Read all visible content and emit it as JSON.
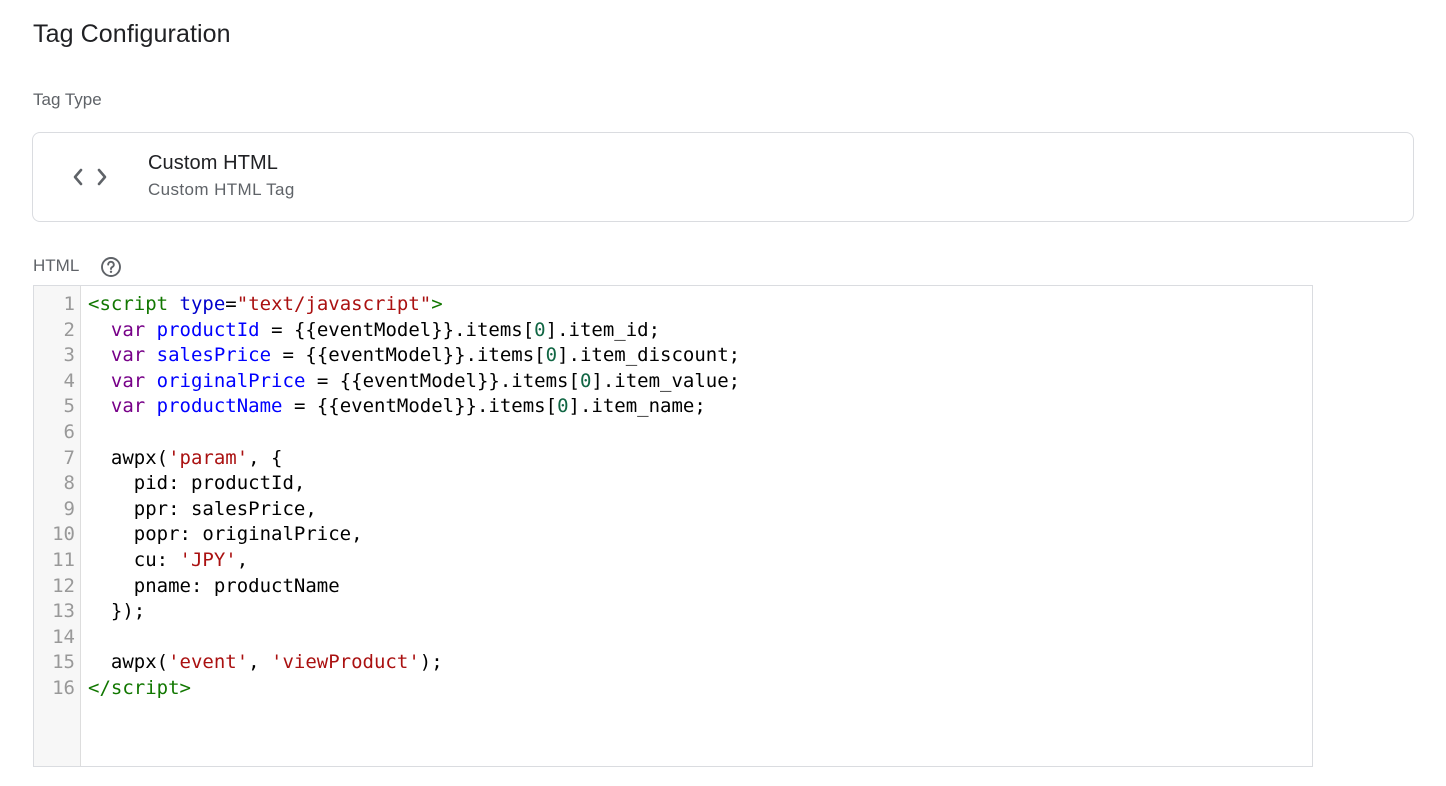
{
  "page": {
    "title": "Tag Configuration"
  },
  "tag_type": {
    "label": "Tag Type",
    "icon": "code-brackets-icon",
    "name": "Custom HTML",
    "description": "Custom HTML Tag"
  },
  "html_field": {
    "label": "HTML",
    "help_icon": "help-circle-icon"
  },
  "colors": {
    "tag": "#117700",
    "attribute": "#0000cc",
    "string": "#aa1111",
    "keyword": "#770088",
    "variable": "#0000ff",
    "number": "#116644",
    "gutter_bg": "#f7f7f7",
    "line_number": "#999999"
  },
  "code": {
    "lines": [
      [
        [
          "tag",
          "<script"
        ],
        [
          "plain",
          " "
        ],
        [
          "attr",
          "type"
        ],
        [
          "plain",
          "="
        ],
        [
          "str",
          "\"text/javascript\""
        ],
        [
          "tag",
          ">"
        ]
      ],
      [
        [
          "plain",
          "  "
        ],
        [
          "kw",
          "var"
        ],
        [
          "plain",
          " "
        ],
        [
          "def",
          "productId"
        ],
        [
          "plain",
          " = {{eventModel}}.items["
        ],
        [
          "num",
          "0"
        ],
        [
          "plain",
          "].item_id;"
        ]
      ],
      [
        [
          "plain",
          "  "
        ],
        [
          "kw",
          "var"
        ],
        [
          "plain",
          " "
        ],
        [
          "def",
          "salesPrice"
        ],
        [
          "plain",
          " = {{eventModel}}.items["
        ],
        [
          "num",
          "0"
        ],
        [
          "plain",
          "].item_discount;"
        ]
      ],
      [
        [
          "plain",
          "  "
        ],
        [
          "kw",
          "var"
        ],
        [
          "plain",
          " "
        ],
        [
          "def",
          "originalPrice"
        ],
        [
          "plain",
          " = {{eventModel}}.items["
        ],
        [
          "num",
          "0"
        ],
        [
          "plain",
          "].item_value;"
        ]
      ],
      [
        [
          "plain",
          "  "
        ],
        [
          "kw",
          "var"
        ],
        [
          "plain",
          " "
        ],
        [
          "def",
          "productName"
        ],
        [
          "plain",
          " = {{eventModel}}.items["
        ],
        [
          "num",
          "0"
        ],
        [
          "plain",
          "].item_name;"
        ]
      ],
      [],
      [
        [
          "plain",
          "  awpx("
        ],
        [
          "str",
          "'param'"
        ],
        [
          "plain",
          ", {"
        ]
      ],
      [
        [
          "plain",
          "    pid: productId,"
        ]
      ],
      [
        [
          "plain",
          "    ppr: salesPrice,"
        ]
      ],
      [
        [
          "plain",
          "    popr: originalPrice,"
        ]
      ],
      [
        [
          "plain",
          "    cu: "
        ],
        [
          "str",
          "'JPY'"
        ],
        [
          "plain",
          ","
        ]
      ],
      [
        [
          "plain",
          "    pname: productName"
        ]
      ],
      [
        [
          "plain",
          "  });"
        ]
      ],
      [],
      [
        [
          "plain",
          "  awpx("
        ],
        [
          "str",
          "'event'"
        ],
        [
          "plain",
          ", "
        ],
        [
          "str",
          "'viewProduct'"
        ],
        [
          "plain",
          ");"
        ]
      ],
      [
        [
          "tag",
          "</script"
        ],
        [
          "tag",
          ">"
        ]
      ]
    ]
  }
}
